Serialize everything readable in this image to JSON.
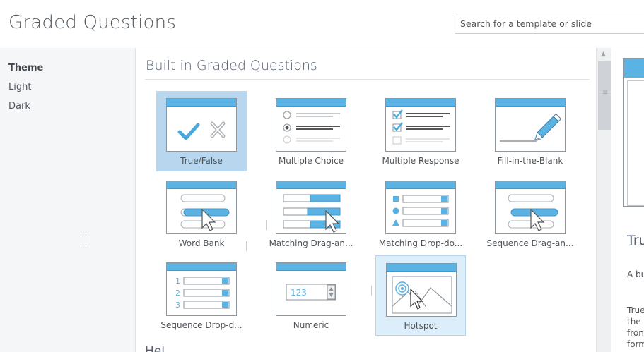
{
  "header": {
    "title": "Graded Questions",
    "search_placeholder": "Search for a template or slide"
  },
  "sidebar": {
    "items": [
      {
        "label": "Theme",
        "active": true
      },
      {
        "label": "Light",
        "active": false
      },
      {
        "label": "Dark",
        "active": false
      }
    ]
  },
  "main": {
    "section_title": "Built in Graded Questions",
    "next_section_partial": "Hel ...",
    "tiles": [
      {
        "label": "True/False",
        "icon": "true-false-icon",
        "state": "selected"
      },
      {
        "label": "Multiple Choice",
        "icon": "multiple-choice-icon",
        "state": "normal"
      },
      {
        "label": "Multiple Response",
        "icon": "multiple-response-icon",
        "state": "normal"
      },
      {
        "label": "Fill-in-the-Blank",
        "icon": "fill-in-the-blank-icon",
        "state": "normal"
      },
      {
        "label": "Word Bank",
        "icon": "word-bank-icon",
        "state": "normal"
      },
      {
        "label": "Matching  Drag-an...",
        "icon": "matching-drag-icon",
        "state": "normal"
      },
      {
        "label": "Matching  Drop-do...",
        "icon": "matching-drop-icon",
        "state": "normal"
      },
      {
        "label": "Sequence  Drag-an...",
        "icon": "sequence-drag-icon",
        "state": "normal"
      },
      {
        "label": "Sequence  Drop-d...",
        "icon": "sequence-drop-icon",
        "state": "normal"
      },
      {
        "label": "Numeric",
        "icon": "numeric-icon",
        "state": "normal"
      },
      {
        "label": "Hotspot",
        "icon": "hotspot-icon",
        "state": "hover"
      }
    ],
    "numeric_sample": "123",
    "sequence_numbers": [
      "1",
      "2",
      "3"
    ]
  },
  "preview": {
    "title": "Tru",
    "subtitle": "A bu",
    "body": "True\nthe r\nfron\nform"
  },
  "colors": {
    "accent": "#5ab3e2",
    "selected_bg": "#b8d7ee",
    "hover_bg": "#dceefa"
  }
}
